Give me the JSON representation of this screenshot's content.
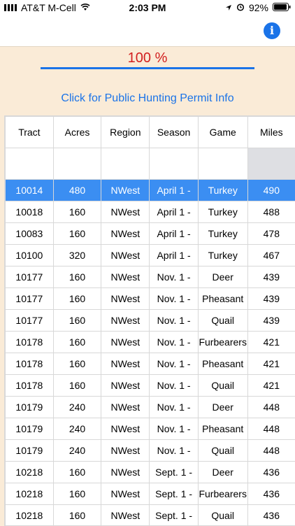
{
  "status": {
    "carrier": "AT&T M-Cell",
    "time": "2:03 PM",
    "battery": "92%"
  },
  "progress": {
    "label": "100 %",
    "value": 1.0
  },
  "permit_link": "Click for Public Hunting Permit Info",
  "table": {
    "columns": [
      "Tract",
      "Acres",
      "Region",
      "Season",
      "Game",
      "Miles"
    ],
    "rows": [
      [
        "10014",
        "480",
        "NWest",
        "April 1 -",
        "Turkey",
        "490"
      ],
      [
        "10018",
        "160",
        "NWest",
        "April 1 -",
        "Turkey",
        "488"
      ],
      [
        "10083",
        "160",
        "NWest",
        "April 1 -",
        "Turkey",
        "478"
      ],
      [
        "10100",
        "320",
        "NWest",
        "April 1 -",
        "Turkey",
        "467"
      ],
      [
        "10177",
        "160",
        "NWest",
        "Nov. 1 -",
        "Deer",
        "439"
      ],
      [
        "10177",
        "160",
        "NWest",
        "Nov. 1 -",
        "Pheasant",
        "439"
      ],
      [
        "10177",
        "160",
        "NWest",
        "Nov. 1 -",
        "Quail",
        "439"
      ],
      [
        "10178",
        "160",
        "NWest",
        "Nov. 1 -",
        "Furbearers",
        "421"
      ],
      [
        "10178",
        "160",
        "NWest",
        "Nov. 1 -",
        "Pheasant",
        "421"
      ],
      [
        "10178",
        "160",
        "NWest",
        "Nov. 1 -",
        "Quail",
        "421"
      ],
      [
        "10179",
        "240",
        "NWest",
        "Nov. 1 -",
        "Deer",
        "448"
      ],
      [
        "10179",
        "240",
        "NWest",
        "Nov. 1 -",
        "Pheasant",
        "448"
      ],
      [
        "10179",
        "240",
        "NWest",
        "Nov. 1 -",
        "Quail",
        "448"
      ],
      [
        "10218",
        "160",
        "NWest",
        "Sept. 1 -",
        "Deer",
        "436"
      ],
      [
        "10218",
        "160",
        "NWest",
        "Sept. 1 -",
        "Furbearers",
        "436"
      ],
      [
        "10218",
        "160",
        "NWest",
        "Sept. 1 -",
        "Quail",
        "436"
      ]
    ],
    "selected_row": 0
  },
  "colors": {
    "accent": "#1a73e8",
    "progress_text": "#d21f1f",
    "background": "#faebd7",
    "selected_row": "#3b8ef2"
  }
}
